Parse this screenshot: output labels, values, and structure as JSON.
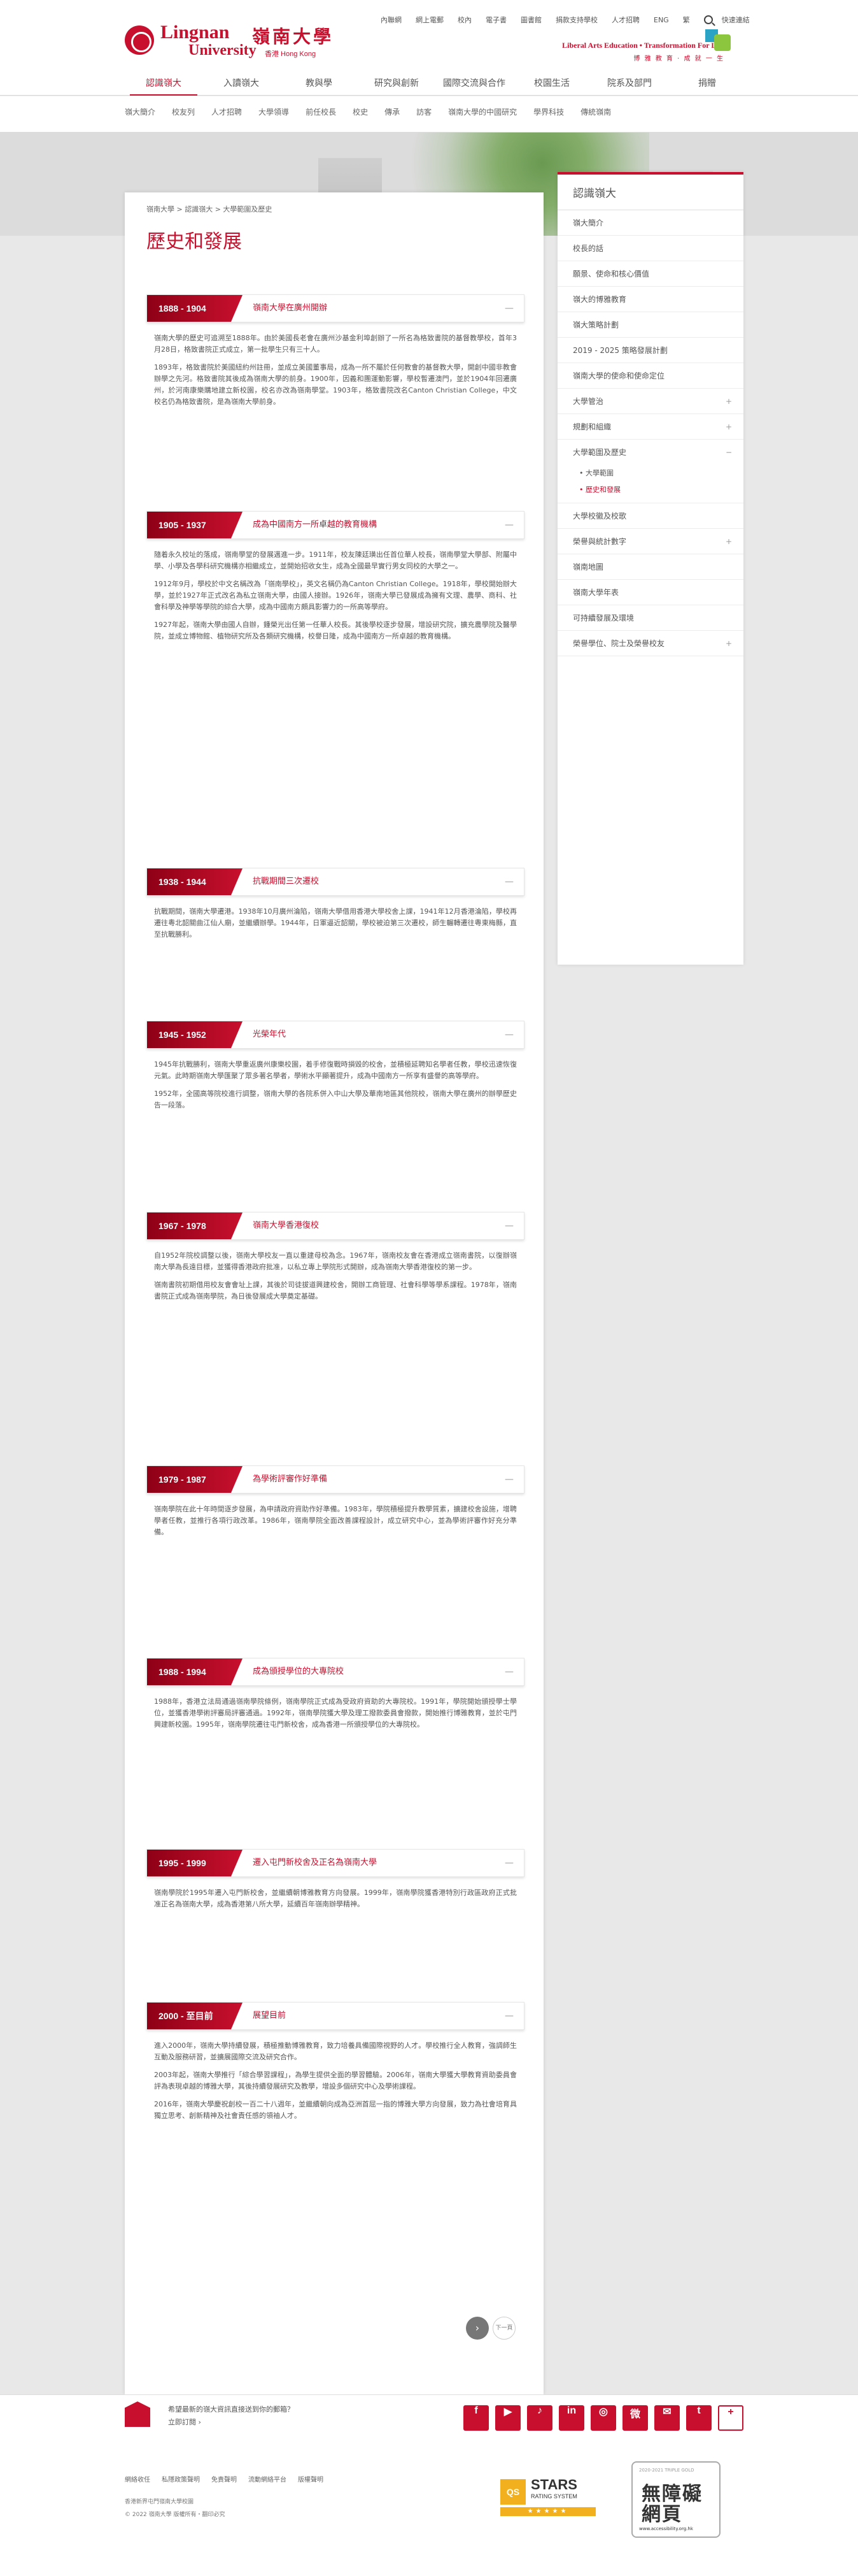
{
  "header": {
    "logo_en_1": "Lingnan",
    "logo_cn": "嶺南大學",
    "logo_en_2": "University",
    "logo_en_3": "香港 Hong Kong",
    "top_links": [
      "內聯網",
      "網上電郵",
      "校內",
      "電子書",
      "圖書館",
      "捐款支持學校",
      "人才招聘"
    ],
    "lang": "ENG",
    "lang2": "繁",
    "quick_links": "快速連結",
    "tagline_1": "Liberal Arts Education • Transformation For Life",
    "tagline_2": "博 雅 教 育 · 成 就 一 生"
  },
  "main_nav": {
    "items": [
      "認識嶺大",
      "入讀嶺大",
      "教與學",
      "研究與創新",
      "國際交流與合作",
      "校園生活",
      "院系及部門",
      "捐贈"
    ]
  },
  "sub_nav": {
    "items": [
      "嶺大簡介",
      "校友列",
      "人才招聘",
      "大學領導",
      "前任校長",
      "校史",
      "傳承",
      "訪客",
      "嶺南大學的中國研究",
      "學界科技",
      "傳統嶺南"
    ]
  },
  "breadcrumb": "嶺南大學 > 認識嶺大 > 大學範圍及歷史",
  "page_title": "歷史和發展",
  "eras": [
    {
      "years": "1888 - 1904",
      "title": "嶺南大學在廣州開辦",
      "paras": [
        "嶺南大學的歷史可追溯至1888年。由於美國長老會在廣州沙基金利埠創辦了一所名為格致書院的基督教學校，首年3月28日，格致書院正式成立，第一批學生只有三十人。",
        "1893年，格致書院於美國紐約州註冊，並成立美國董事局，成為一所不屬於任何教會的基督教大學，開創中國非教會辦學之先河。格致書院其後成為嶺南大學的前身。1900年，因義和團運動影響，學校暫遷澳門，並於1904年回遷廣州，於河南康樂購地建立新校園，校名亦改為嶺南學堂。1903年，格致書院改名Canton Christian College，中文校名仍為格致書院，是為嶺南大學前身。"
      ]
    },
    {
      "years": "1905 - 1937",
      "title": "成為中國南方一所卓越的教育機構",
      "paras": [
        "隨着永久校址的落成，嶺南學堂的發展邁進一步。1911年，校友陳廷璜出任首位華人校長，嶺南學堂大學部、附屬中學、小學及各學科研究機構亦相繼成立，並開始招收女生，成為全國最早實行男女同校的大學之一。",
        "1912年9月，學校於中文名稱改為「嶺南學校」，英文名稱仍為Canton Christian College。1918年，學校開始辦大學，並於1927年正式改名為私立嶺南大學，由國人接辦。1926年，嶺南大學已發展成為擁有文理、農學、商科、社會科學及神學等學院的綜合大學，成為中國南方頗具影響力的一所高等學府。",
        "1927年起，嶺南大學由國人自辦，鍾榮光出任第一任華人校長。其後學校逐步發展，增設研究院，擴充農學院及醫學院，並成立博物館、植物研究所及各類研究機構，校譽日隆，成為中國南方一所卓越的教育機構。"
      ]
    },
    {
      "years": "1938 - 1944",
      "title": "抗戰期間三次遷校",
      "paras": [
        "抗戰期間，嶺南大學遷港。1938年10月廣州淪陷，嶺南大學借用香港大學校舍上課，1941年12月香港淪陷，學校再遷往粵北韶關曲江仙人廟，並繼續辦學。1944年，日軍逼近韶關，學校被迫第三次遷校，師生輾轉遷往粵東梅縣，直至抗戰勝利。"
      ]
    },
    {
      "years": "1945 - 1952",
      "title": "光榮年代",
      "paras": [
        "1945年抗戰勝利，嶺南大學重返廣州康樂校園，着手修復戰時損毀的校舍，並積極延聘知名學者任教，學校迅速恢復元氣。此時期嶺南大學匯聚了眾多著名學者，學術水平顯著提升，成為中國南方一所享有盛譽的高等學府。",
        "1952年，全國高等院校進行調整，嶺南大學的各院系併入中山大學及華南地區其他院校，嶺南大學在廣州的辦學歷史告一段落。"
      ]
    },
    {
      "years": "1967 - 1978",
      "title": "嶺南大學香港復校",
      "paras": [
        "自1952年院校調整以後，嶺南大學校友一直以重建母校為念。1967年，嶺南校友會在香港成立嶺南書院，以復辦嶺南大學為長遠目標，並獲得香港政府批准，以私立專上學院形式開辦，成為嶺南大學香港復校的第一步。",
        "嶺南書院初期借用校友會會址上課，其後於司徒拔道興建校舍，開辦工商管理、社會科學等學系課程。1978年，嶺南書院正式成為嶺南學院，為日後發展成大學奠定基礎。"
      ]
    },
    {
      "years": "1979 - 1987",
      "title": "為學術評審作好準備",
      "paras": [
        "嶺南學院在此十年時間逐步發展，為申請政府資助作好準備。1983年，學院積極提升教學質素，擴建校舍設施，增聘學者任教，並推行各項行政改革。1986年，嶺南學院全面改善課程設計，成立研究中心，並為學術評審作好充分準備。"
      ]
    },
    {
      "years": "1988 - 1994",
      "title": "成為頒授學位的大專院校",
      "paras": [
        "1988年，香港立法局通過嶺南學院條例，嶺南學院正式成為受政府資助的大專院校。1991年，學院開始頒授學士學位，並獲香港學術評審局評審通過。1992年，嶺南學院獲大學及理工撥款委員會撥款，開始推行博雅教育，並於屯門興建新校園。1995年，嶺南學院遷往屯門新校舍，成為香港一所頒授學位的大專院校。"
      ]
    },
    {
      "years": "1995 - 1999",
      "title": "遷入屯門新校舍及正名為嶺南大學",
      "paras": [
        "嶺南學院於1995年遷入屯門新校舍，並繼續朝博雅教育方向發展。1999年，嶺南學院獲香港特別行政區政府正式批准正名為嶺南大學，成為香港第八所大學，延續百年嶺南辦學精神。"
      ]
    },
    {
      "years": "2000 - 至目前",
      "title": "展望目前",
      "paras": [
        "進入2000年，嶺南大學持續發展，積極推動博雅教育，致力培養具備國際視野的人才。學校推行全人教育，強調師生互動及服務研習，並擴展國際交流及研究合作。",
        "2003年起，嶺南大學推行「綜合學習課程」，為學生提供全面的學習體驗。2006年，嶺南大學獲大學教育資助委員會評為表現卓越的博雅大學，其後持續發展研究及教學，增設多個研究中心及學術課程。",
        "2016年，嶺南大學慶祝創校一百二十八週年，並繼續朝向成為亞洲首屈一指的博雅大學方向發展，致力為社會培育具獨立思考、創新精神及社會責任感的領袖人才。"
      ]
    }
  ],
  "pager": {
    "next_symbol": "›",
    "next_label": "下一頁"
  },
  "sidebar": {
    "title": "認識嶺大",
    "items": [
      {
        "label": "嶺大簡介",
        "expand": ""
      },
      {
        "label": "校長的話",
        "expand": ""
      },
      {
        "label": "願景、使命和核心價值",
        "expand": ""
      },
      {
        "label": "嶺大的博雅教育",
        "expand": ""
      },
      {
        "label": "嶺大策略計劃",
        "expand": ""
      },
      {
        "label": "2019 - 2025 策略發展計劃",
        "expand": ""
      },
      {
        "label": "嶺南大學的使命和使命定位",
        "expand": ""
      },
      {
        "label": "大學管治",
        "expand": "+"
      },
      {
        "label": "規劃和組織",
        "expand": "+"
      },
      {
        "label": "大學範圍及歷史",
        "expand": "−"
      }
    ],
    "subitems": [
      "大學範圍",
      "歷史和發展"
    ],
    "items2": [
      {
        "label": "大學校徽及校歌",
        "expand": ""
      },
      {
        "label": "榮譽與統計數字",
        "expand": "+"
      },
      {
        "label": "嶺南地圖",
        "expand": ""
      },
      {
        "label": "嶺南大學年表",
        "expand": ""
      },
      {
        "label": "可持續發展及環境",
        "expand": ""
      },
      {
        "label": "榮譽學位、院士及榮譽校友",
        "expand": "+"
      }
    ]
  },
  "footer": {
    "newsletter_text": "希望最新的嶺大資訊直接送到你的郵箱？",
    "newsletter_link": "立即訂閱 ›",
    "social": [
      "f",
      "▶",
      "♪",
      "in",
      "◎",
      "微",
      "✉",
      "t",
      "+"
    ],
    "links": [
      "網絡收任",
      "私隱政策聲明",
      "免責聲明",
      "流動網絡平台",
      "版權聲明"
    ],
    "address": "香港新界屯門嶺南大學校園",
    "copyright": "© 2022 嶺南大學 版權所有・翻印必究",
    "qs": "QS",
    "stars_1": "STARS",
    "stars_2": "RATING SYSTEM",
    "stars_3": "★★★★★",
    "access_1": "2020-2021 TRIPLE GOLD",
    "access_2": "無障礙網頁",
    "access_3": "www.accessibility.org.hk"
  },
  "colors": {
    "brand": "#c8102e",
    "background": "#e8e8e8"
  }
}
